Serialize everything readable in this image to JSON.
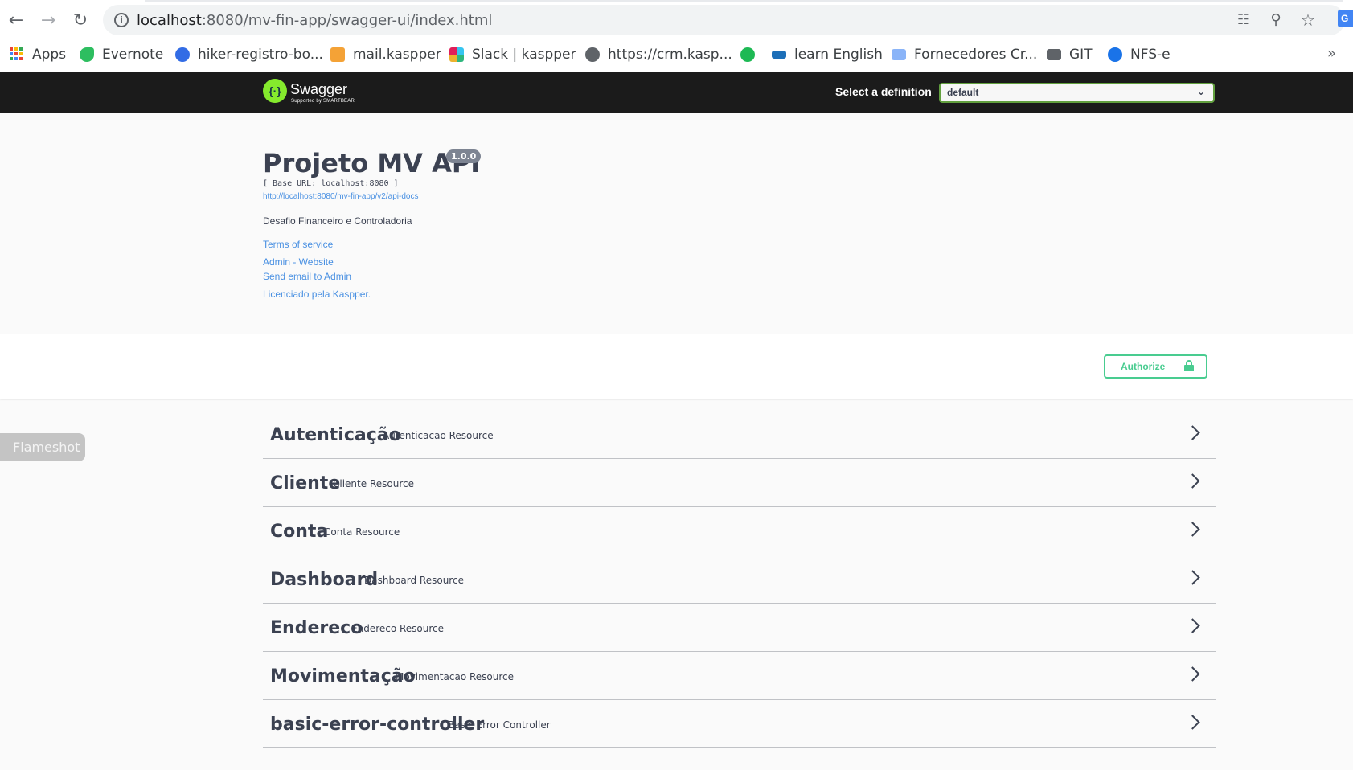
{
  "browser": {
    "url_host": "localhost",
    "url_path": ":8080/mv-fin-app/swagger-ui/index.html",
    "bookmarks": [
      {
        "label": "Apps",
        "icon": "apps-grid-icon"
      },
      {
        "label": "Evernote",
        "icon": "evernote-icon"
      },
      {
        "label": "hiker-registro-bo...",
        "icon": "kubernetes-icon"
      },
      {
        "label": "mail.kaspper",
        "icon": "mail-icon"
      },
      {
        "label": "Slack | kaspper",
        "icon": "slack-icon"
      },
      {
        "label": "https://crm.kasp...",
        "icon": "globe-icon"
      },
      {
        "label": "",
        "icon": "bolt-icon"
      },
      {
        "label": "learn English",
        "icon": "vocabulary-icon"
      },
      {
        "label": "Fornecedores Cr...",
        "icon": "envelope-icon"
      },
      {
        "label": "GIT",
        "icon": "folder-icon"
      },
      {
        "label": "NFS-e",
        "icon": "world-icon"
      }
    ],
    "colors": {
      "chrome_bg": "#ffffff",
      "omnibox_bg": "#f1f3f4"
    }
  },
  "swagger_bar": {
    "logo_text": "Swagger",
    "logo_subtext": "Supported by SMARTBEAR",
    "definition_label": "Select a definition",
    "definition_value": "default",
    "colors": {
      "bar_bg": "#1b1b1b",
      "logo_green": "#85ea2d",
      "select_border": "#62a03f"
    }
  },
  "info": {
    "title": "Projeto MV API",
    "version": "1.0.0",
    "base_url": "[ Base URL: localhost:8080 ]",
    "api_docs_link": "http://localhost:8080/mv-fin-app/v2/api-docs",
    "description": "Desafio Financeiro e Controladoria",
    "terms_of_service": "Terms of service",
    "contact_website": "Admin - Website",
    "contact_email": "Send email to Admin",
    "license": "Licenciado pela Kaspper."
  },
  "authorize": {
    "label": "Authorize",
    "color": "#49cc90"
  },
  "flameshot": {
    "label": "Flameshot"
  },
  "tags": [
    {
      "name": "Autenticação",
      "description": "Autenticacao Resource"
    },
    {
      "name": "Cliente",
      "description": "Cliente Resource"
    },
    {
      "name": "Conta",
      "description": "Conta Resource"
    },
    {
      "name": "Dashboard",
      "description": "Dashboard Resource"
    },
    {
      "name": "Endereco",
      "description": "Endereco Resource"
    },
    {
      "name": "Movimentação",
      "description": "Movimentacao Resource"
    },
    {
      "name": "basic-error-controller",
      "description": "Basic Error Controller"
    }
  ]
}
